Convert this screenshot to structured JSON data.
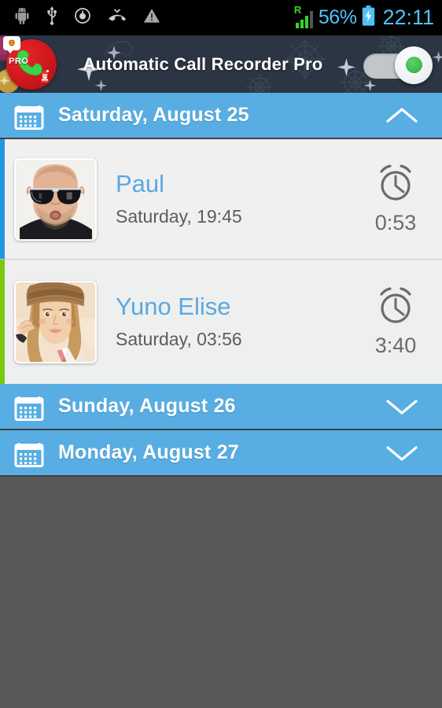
{
  "status_bar": {
    "icons": [
      "android-debug-icon",
      "usb-icon",
      "recording-target-icon",
      "missed-call-icon",
      "warning-triangle-icon"
    ],
    "roaming_indicator": "R",
    "signal_bars": 3,
    "battery_percent": "56%",
    "battery_state": "charging",
    "clock": "22:11",
    "accent_color": "#4FC3F7",
    "signal_color": "#3BD12A",
    "background_color": "#000000"
  },
  "title_bar": {
    "app_name": "Automatic Call Recorder Pro",
    "app_icon_label": "PRO",
    "background_color": "#2b3543",
    "decoration": "snowflakes-and-ornaments",
    "recording_toggle": {
      "label": "recording-toggle",
      "state": "on",
      "on_color": "#3cb84c",
      "track_color": "#c3c6c8"
    }
  },
  "theme": {
    "header_blue": "#58ade3",
    "row_background": "#eeeeee",
    "name_blue": "#5ba8e0",
    "outgoing_accent": "#2196e3",
    "incoming_accent": "#7ac70e",
    "empty_background": "#585858"
  },
  "groups": [
    {
      "date_label": "Saturday, August 25",
      "expanded": true,
      "chevron": "chevron-up-icon",
      "calls": [
        {
          "name": "Paul",
          "time": "Saturday, 19:45",
          "duration": "0:53",
          "accent": "blue",
          "avatar": "man-with-sunglasses"
        },
        {
          "name": "Yuno Elise",
          "time": "Saturday, 03:56",
          "duration": "3:40",
          "accent": "green",
          "avatar": "woman-with-beanie"
        }
      ]
    },
    {
      "date_label": "Sunday, August 26",
      "expanded": false,
      "chevron": "chevron-down-icon",
      "calls": []
    },
    {
      "date_label": "Monday, August 27",
      "expanded": false,
      "chevron": "chevron-down-icon",
      "calls": []
    }
  ]
}
